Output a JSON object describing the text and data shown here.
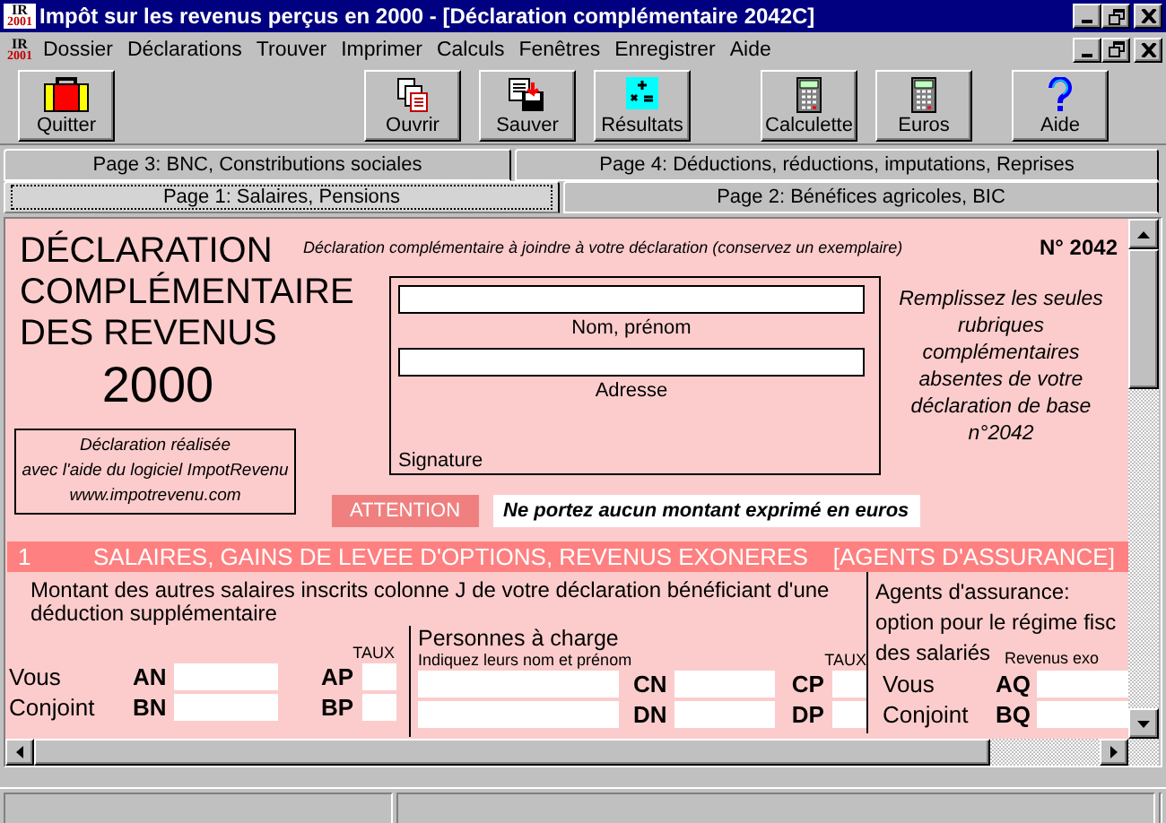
{
  "window": {
    "title": "Impôt sur les revenus perçus en 2000 - [Déclaration complémentaire 2042C]",
    "logo": [
      "IR",
      "2001"
    ]
  },
  "menu": {
    "logo": [
      "IR",
      "2001"
    ],
    "items": [
      "Dossier",
      "Déclarations",
      "Trouver",
      "Imprimer",
      "Calculs",
      "Fenêtres",
      "Enregistrer",
      "Aide"
    ]
  },
  "toolbar": [
    {
      "label": "Quitter",
      "kind": "briefcase"
    },
    {
      "label": "Ouvrir",
      "kind": "documents"
    },
    {
      "label": "Sauver",
      "kind": "save"
    },
    {
      "label": "Résultats",
      "kind": "results"
    },
    {
      "label": "Calculette",
      "kind": "calculator"
    },
    {
      "label": "Euros",
      "kind": "calculator"
    },
    {
      "label": "Aide",
      "kind": "help"
    }
  ],
  "tab_rows": [
    [
      {
        "label": "Page 3: BNC, Constributions sociales",
        "selected": false
      },
      {
        "label": "Page 4: Déductions, réductions, imputations, Reprises",
        "selected": false
      }
    ],
    [
      {
        "label": "Page 1:  Salaires, Pensions",
        "selected": true
      },
      {
        "label": "Page 2: Bénéfices agricoles, BIC",
        "selected": false
      }
    ]
  ],
  "form": {
    "title_lines": [
      "DÉCLARATION",
      "COMPLÉMENTAIRE",
      "DES REVENUS"
    ],
    "year": "2000",
    "subtitle": "Déclaration complémentaire à joindre à votre déclaration (conservez un exemplaire)",
    "number": "N° 2042",
    "credit_lines": [
      "Déclaration réalisée",
      "avec l'aide du logiciel ImpotRevenu",
      "www.impotrevenu.com"
    ],
    "identity_fields": [
      {
        "label": "Nom, prénom"
      },
      {
        "label": "Adresse"
      }
    ],
    "signature": "Signature",
    "note": "Remplissez les seules rubriques complémentaires absentes de votre déclaration de base n°2042",
    "attention": "ATTENTION",
    "warning": "Ne portez aucun montant exprimé en euros",
    "section": {
      "number": "1",
      "title": "SALAIRES, GAINS DE LEVEE D'OPTIONS, REVENUS EXONERES",
      "tag": "[AGENTS D'ASSURANCE]",
      "intro": "Montant des autres salaires inscrits colonne J de votre déclaration bénéficiant d'une déduction supplémentaire",
      "taux": "TAUX",
      "rows": [
        {
          "label": "Vous",
          "code": "AN",
          "taux_code": "AP"
        },
        {
          "label": "Conjoint",
          "code": "BN",
          "taux_code": "BP"
        }
      ],
      "dependents": {
        "title": "Personnes à charge",
        "hint": "Indiquez leurs nom et prénom",
        "taux": "TAUX",
        "rows": [
          {
            "code": "CN",
            "taux_code": "CP"
          },
          {
            "code": "DN",
            "taux_code": "DP"
          }
        ]
      },
      "agents": {
        "title_lines": [
          "Agents d'assurance:",
          "option pour le régime fisc",
          "des salariés"
        ],
        "column": "Revenus exo",
        "rows": [
          {
            "label": "Vous",
            "code": "AQ"
          },
          {
            "label": "Conjoint",
            "code": "BQ"
          }
        ]
      }
    }
  }
}
